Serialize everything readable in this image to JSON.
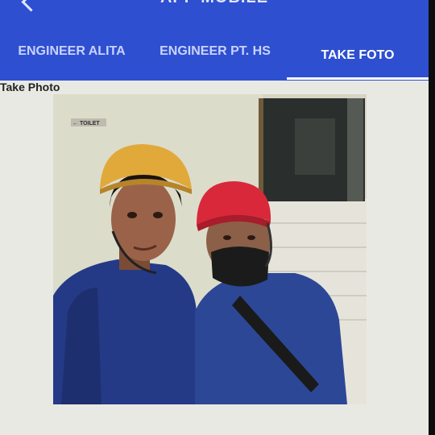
{
  "app": {
    "title": "APP MOBILE",
    "back_icon": "arrow-back-icon",
    "bar_color": "#2e4fd0"
  },
  "tabs": [
    {
      "label": "ENGINEER ALITA",
      "active": false
    },
    {
      "label": "ENGINEER PT. HS",
      "active": false
    },
    {
      "label": "TAKE FOTO",
      "active": true
    }
  ],
  "section": {
    "label": "Take Photo"
  },
  "photo": {
    "sign_text": "← TOILET"
  }
}
